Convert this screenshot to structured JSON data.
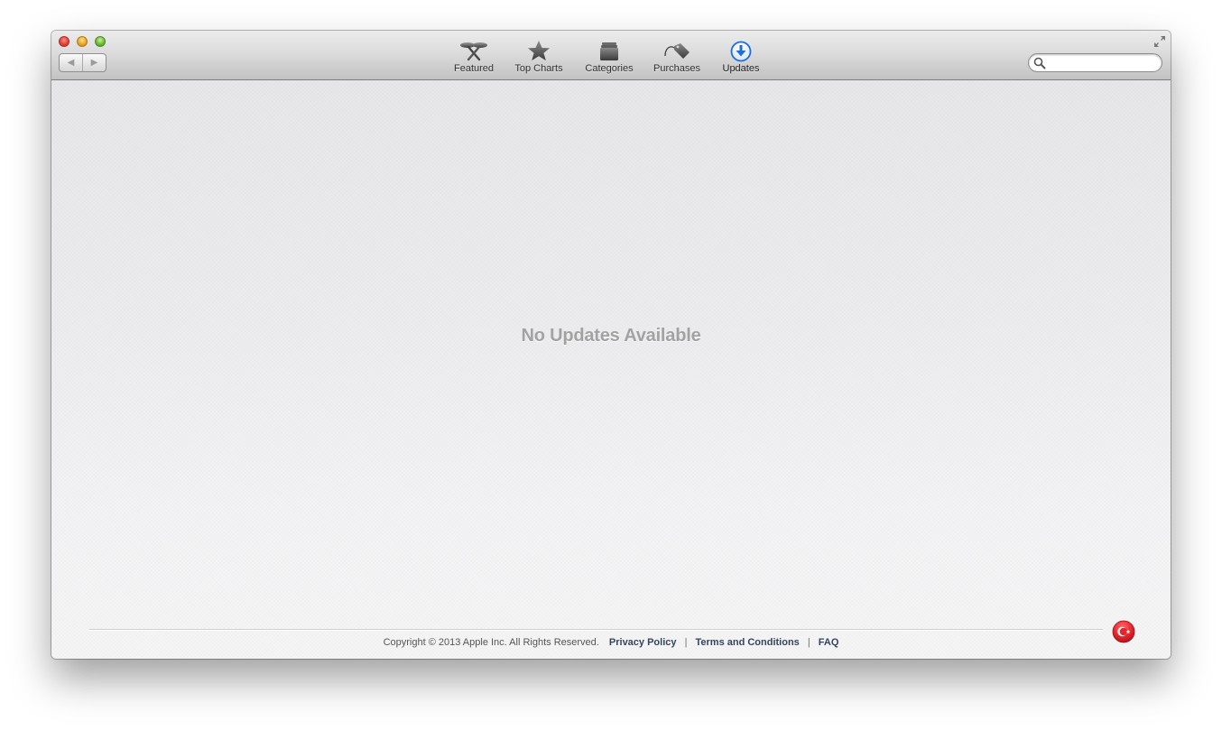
{
  "window": {
    "controls": [
      "close",
      "minimize",
      "zoom"
    ]
  },
  "navigation": {
    "back_icon": "back-arrow-icon",
    "forward_icon": "forward-arrow-icon",
    "back_glyph": "◀",
    "forward_glyph": "▶"
  },
  "toolbar": {
    "items": [
      {
        "label": "Featured",
        "icon": "featured-icon",
        "active": false
      },
      {
        "label": "Top Charts",
        "icon": "star-icon",
        "active": false
      },
      {
        "label": "Categories",
        "icon": "categories-icon",
        "active": false
      },
      {
        "label": "Purchases",
        "icon": "price-tag-icon",
        "active": false
      },
      {
        "label": "Updates",
        "icon": "download-arrow-icon",
        "active": true
      }
    ]
  },
  "search": {
    "value": "",
    "placeholder": "",
    "icon": "search-icon"
  },
  "main": {
    "empty_message": "No Updates Available"
  },
  "footer": {
    "copyright": "Copyright © 2013 Apple Inc. All Rights Reserved.",
    "links": [
      "Privacy Policy",
      "Terms and Conditions",
      "FAQ"
    ],
    "separator": "|",
    "region_badge": "turkey-flag-icon"
  },
  "colors": {
    "accent_blue": "#1d6fd6",
    "link_color": "#34455d",
    "empty_text": "#a2a2a2",
    "badge_red": "#e3242b"
  }
}
